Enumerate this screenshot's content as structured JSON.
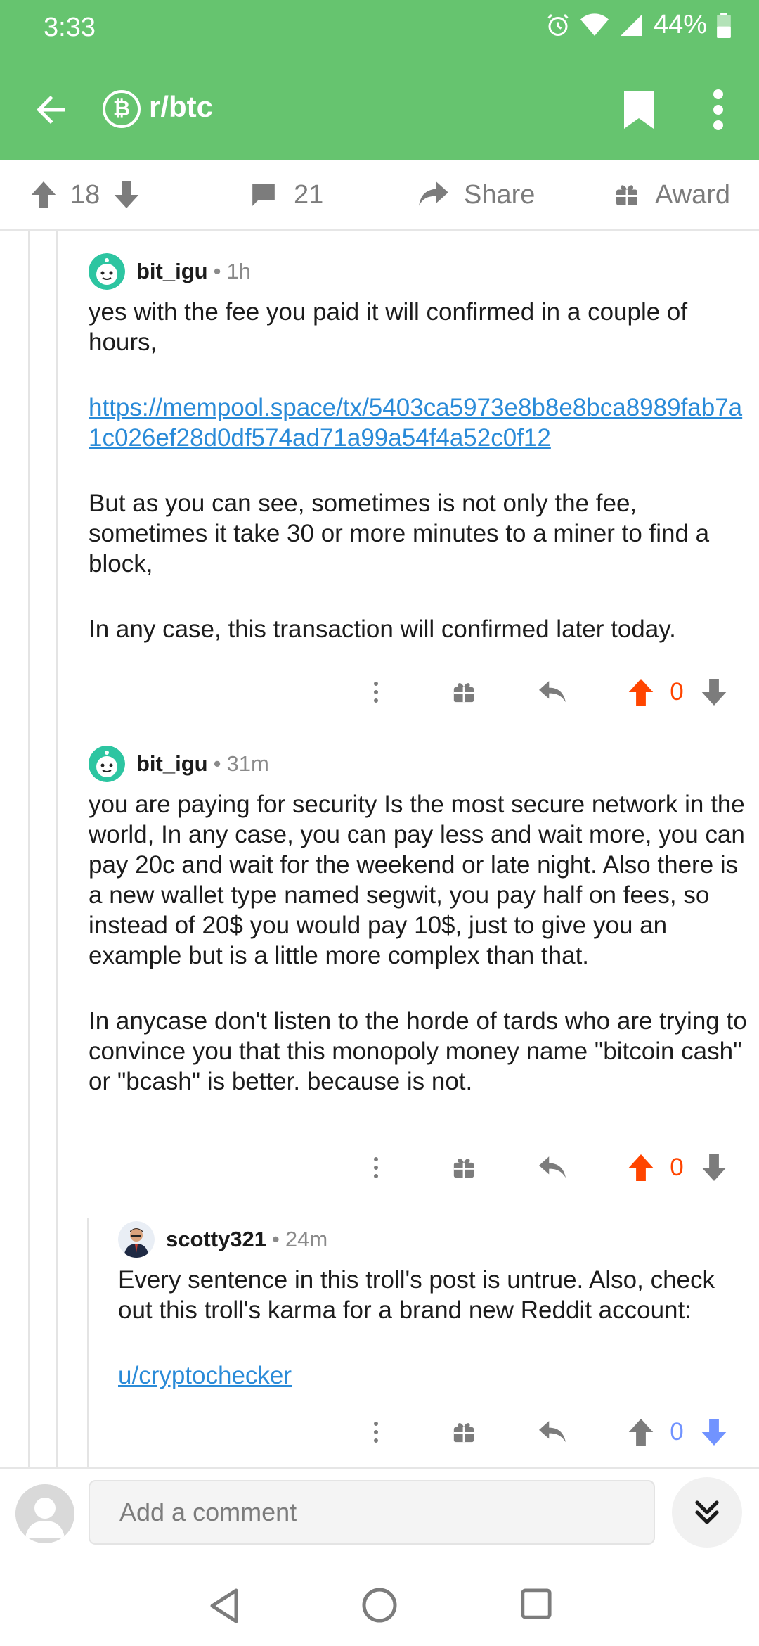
{
  "status": {
    "time": "3:33",
    "battery": "44%"
  },
  "appbar": {
    "subreddit": "r/btc",
    "sub_icon_glyph": "₿"
  },
  "post_actions": {
    "upvotes": "18",
    "comments": "21",
    "share_label": "Share",
    "award_label": "Award"
  },
  "comments": [
    {
      "author": "bit_igu",
      "age": "1h",
      "paragraphs": [
        "yes with the fee you paid it will confirmed in a couple of hours,",
        "But as you can see, sometimes is not only the fee, sometimes it take 30 or more minutes to a miner to find a block,",
        "In any case, this transaction will confirmed later today."
      ],
      "link": "https://mempool.space/tx/5403ca5973e8b8e8bca8989fab7a1c026ef28d0df574ad71a99a54f4a52c0f12",
      "score": "0",
      "vote_state": "up"
    },
    {
      "author": "bit_igu",
      "age": "31m",
      "paragraphs": [
        "you are paying for security Is the most secure network in the world, In any case, you can pay less and wait more, you can pay 20c and wait for the weekend or late night. Also there is a new wallet type named segwit, you pay half on fees, so instead of 20$ you would pay 10$, just to give you an example but is a little more complex than that.",
        "In anycase don't listen to the horde of tards who are trying to convince you that this monopoly money name \"bitcoin cash\" or \"bcash\" is better. because is not."
      ],
      "score": "0",
      "vote_state": "up"
    },
    {
      "author": "scotty321",
      "age": "24m",
      "paragraphs": [
        "Every sentence in this troll's post is untrue. Also, check out this troll's karma for a brand new Reddit account:"
      ],
      "link": "u/cryptochecker",
      "score": "0",
      "vote_state": "down"
    }
  ],
  "composer": {
    "placeholder": "Add a comment"
  },
  "colors": {
    "brand": "#66c46f",
    "upvote": "#ff4500",
    "downvote": "#7193ff",
    "link": "#2a8bd8",
    "icon_gray": "#7c7c7c"
  },
  "icons": [
    "back-arrow-icon",
    "bitcoin-icon",
    "bookmark-icon",
    "more-vert-icon",
    "upvote-icon",
    "downvote-icon",
    "comment-icon",
    "share-icon",
    "gift-icon",
    "reply-icon",
    "collapse-icon"
  ]
}
